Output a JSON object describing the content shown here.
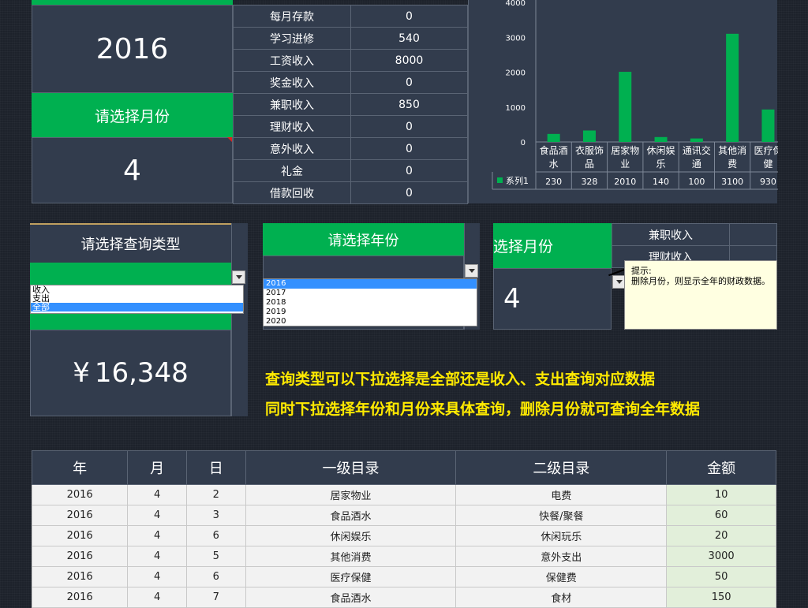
{
  "summary": {
    "year": "2016",
    "month_prompt": "请选择月份",
    "month": "4"
  },
  "income_rows": [
    {
      "label": "每月存款",
      "value": "0"
    },
    {
      "label": "学习进修",
      "value": "540"
    },
    {
      "label": "工资收入",
      "value": "8000"
    },
    {
      "label": "奖金收入",
      "value": "0"
    },
    {
      "label": "兼职收入",
      "value": "850"
    },
    {
      "label": "理财收入",
      "value": "0"
    },
    {
      "label": "意外收入",
      "value": "0"
    },
    {
      "label": "礼金",
      "value": "0"
    },
    {
      "label": "借款回收",
      "value": "0"
    }
  ],
  "chart_data": {
    "type": "bar",
    "categories": [
      "食品酒水",
      "衣服饰品",
      "居家物业",
      "休闲娱乐",
      "通讯交通",
      "其他消费",
      "医疗保健"
    ],
    "category_labels": [
      [
        "食品酒",
        "水"
      ],
      [
        "衣服饰",
        "品"
      ],
      [
        "居家物",
        "业"
      ],
      [
        "休闲娱",
        "乐"
      ],
      [
        "通讯交",
        "通"
      ],
      [
        "其他消",
        "费"
      ],
      [
        "医疗保",
        "健"
      ]
    ],
    "series": [
      {
        "name": "系列1",
        "values": [
          230,
          328,
          2010,
          140,
          100,
          3100,
          930
        ]
      }
    ],
    "value_labels": [
      "230",
      "328",
      "2010",
      "140",
      "100",
      "3100",
      "930"
    ],
    "yticks": [
      "0",
      "1000",
      "2000",
      "3000",
      "4000"
    ],
    "ylim": [
      0,
      4000
    ],
    "bar_color": "#00b050"
  },
  "query_type": {
    "label": "请选择查询类型",
    "options": [
      "收入",
      "支出",
      "全部"
    ],
    "selected_index": 2,
    "amount_symbol": "¥",
    "amount": "16,348"
  },
  "year_select": {
    "label": "请选择年份",
    "options": [
      "2016",
      "2017",
      "2018",
      "2019",
      "2020"
    ],
    "selected_index": 0
  },
  "month_select": {
    "label": "选择月份",
    "value": "4",
    "side_rows": [
      "兼职收入",
      "理财收入"
    ],
    "tip_title": "提示:",
    "tip_text": "删除月份，则显示全年的财政数据。"
  },
  "notes": [
    "查询类型可以下拉选择是全部还是收入、支出查询对应数据",
    "同时下拉选择年份和月份来具体查询，删除月份就可查询全年数据"
  ],
  "table": {
    "headers": [
      "年",
      "月",
      "日",
      "一级目录",
      "二级目录",
      "金额"
    ],
    "rows": [
      [
        "2016",
        "4",
        "2",
        "居家物业",
        "电费",
        "10"
      ],
      [
        "2016",
        "4",
        "3",
        "食品酒水",
        "快餐/聚餐",
        "60"
      ],
      [
        "2016",
        "4",
        "6",
        "休闲娱乐",
        "休闲玩乐",
        "20"
      ],
      [
        "2016",
        "4",
        "5",
        "其他消费",
        "意外支出",
        "3000"
      ],
      [
        "2016",
        "4",
        "6",
        "医疗保健",
        "保健费",
        "50"
      ],
      [
        "2016",
        "4",
        "7",
        "食品酒水",
        "食材",
        "150"
      ]
    ]
  }
}
